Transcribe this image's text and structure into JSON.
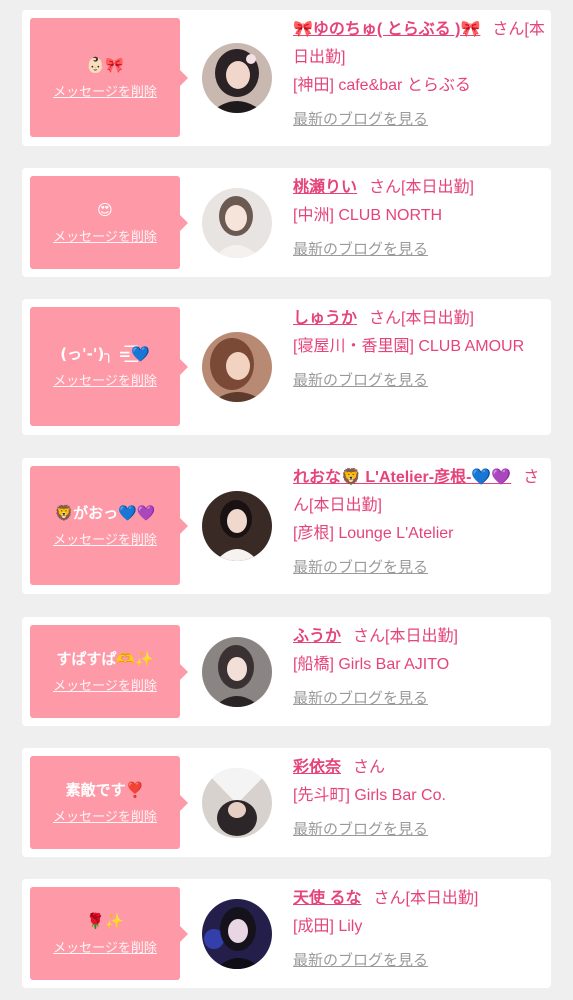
{
  "delete_label": "メッセージを削除",
  "blog_label": "最新のブログを見る",
  "colors": {
    "page_bg": "#efefef",
    "card_bg": "#ffffff",
    "bubble_bg": "#fe9aa8",
    "name_pink": "#e5447a",
    "link_gray": "#9a9a9a"
  },
  "entries": [
    {
      "message": "👶🏻🎀",
      "name": "🎀ゆのちゅ( とらぶる )🎀",
      "suffix": "さん[本日出勤]",
      "shop": "[神田] cafe&bar とらぶる",
      "avatar_icon": "woman-photo-avatar"
    },
    {
      "message": "😍",
      "name": "桃瀬りい",
      "suffix": "さん[本日出勤]",
      "shop": "[中洲] CLUB NORTH",
      "avatar_icon": "woman-photo-avatar"
    },
    {
      "message": "(っ'-')╮ =͟͟͞͞💙",
      "name": "しゅうか",
      "suffix": "さん[本日出勤]",
      "shop": "[寝屋川・香里園] CLUB AMOUR",
      "avatar_icon": "woman-photo-avatar"
    },
    {
      "message": "🦁がおっ💙💜",
      "name": "れおな🦁 L'Atelier-彦根-💙💜",
      "suffix": "さん[本日出勤]",
      "shop": "[彦根] Lounge L'Atelier",
      "avatar_icon": "woman-photo-avatar"
    },
    {
      "message": "すぱすぱ🫶✨",
      "name": "ふうか",
      "suffix": "さん[本日出勤]",
      "shop": "[船橋] Girls Bar AJITO",
      "avatar_icon": "woman-photo-avatar"
    },
    {
      "message": "素敵です❣️",
      "name": "彩依奈",
      "suffix": "さん",
      "shop": "[先斗町] Girls Bar Co.",
      "avatar_icon": "woman-photo-avatar"
    },
    {
      "message": "🌹✨",
      "name": "天使 るな",
      "suffix": "さん[本日出勤]",
      "shop": "[成田] Lily",
      "avatar_icon": "woman-photo-avatar"
    }
  ]
}
